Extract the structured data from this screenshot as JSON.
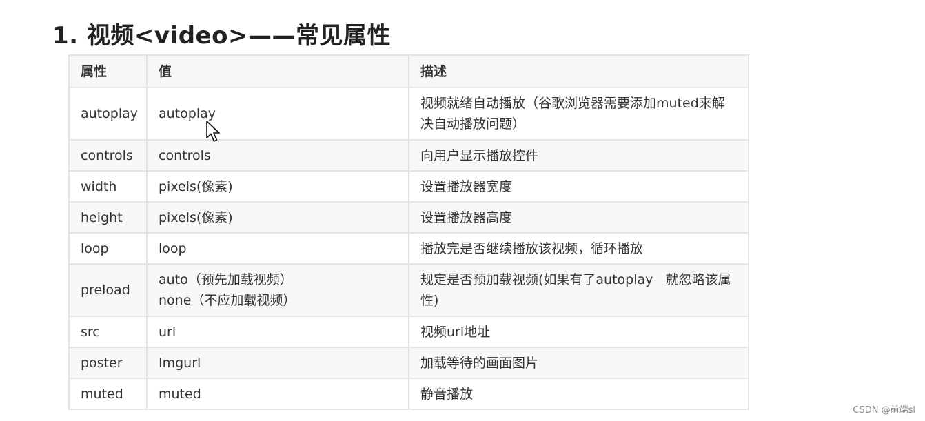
{
  "title": "1. 视频<video>——常见属性",
  "table": {
    "headers": [
      "属性",
      "值",
      "描述"
    ],
    "rows": [
      {
        "attr": "autoplay",
        "value": [
          "autoplay"
        ],
        "desc": [
          "视频就绪自动播放（谷歌浏览器需要添加muted来解",
          "决自动播放问题）"
        ]
      },
      {
        "attr": "controls",
        "value": [
          "controls"
        ],
        "desc": [
          "向用户显示播放控件"
        ]
      },
      {
        "attr": "width",
        "value": [
          "pixels(像素)"
        ],
        "desc": [
          "设置播放器宽度"
        ]
      },
      {
        "attr": "height",
        "value": [
          "pixels(像素)"
        ],
        "desc": [
          "设置播放器高度"
        ]
      },
      {
        "attr": "loop",
        "value": [
          "loop"
        ],
        "desc": [
          "播放完是否继续播放该视频，循环播放"
        ]
      },
      {
        "attr": "preload",
        "value": [
          "auto（预先加载视频）",
          "none（不应加载视频）"
        ],
        "desc": [
          "规定是否预加载视频(如果有了autoplay   就忽略该属",
          "性)"
        ]
      },
      {
        "attr": "src",
        "value": [
          "url"
        ],
        "desc": [
          "视频url地址"
        ]
      },
      {
        "attr": "poster",
        "value": [
          "Imgurl"
        ],
        "desc": [
          "加载等待的画面图片"
        ]
      },
      {
        "attr": "muted",
        "value": [
          "muted"
        ],
        "desc": [
          "静音播放"
        ]
      }
    ]
  },
  "cursor_icon": "mouse-pointer-icon",
  "watermark": "CSDN @前端sl"
}
